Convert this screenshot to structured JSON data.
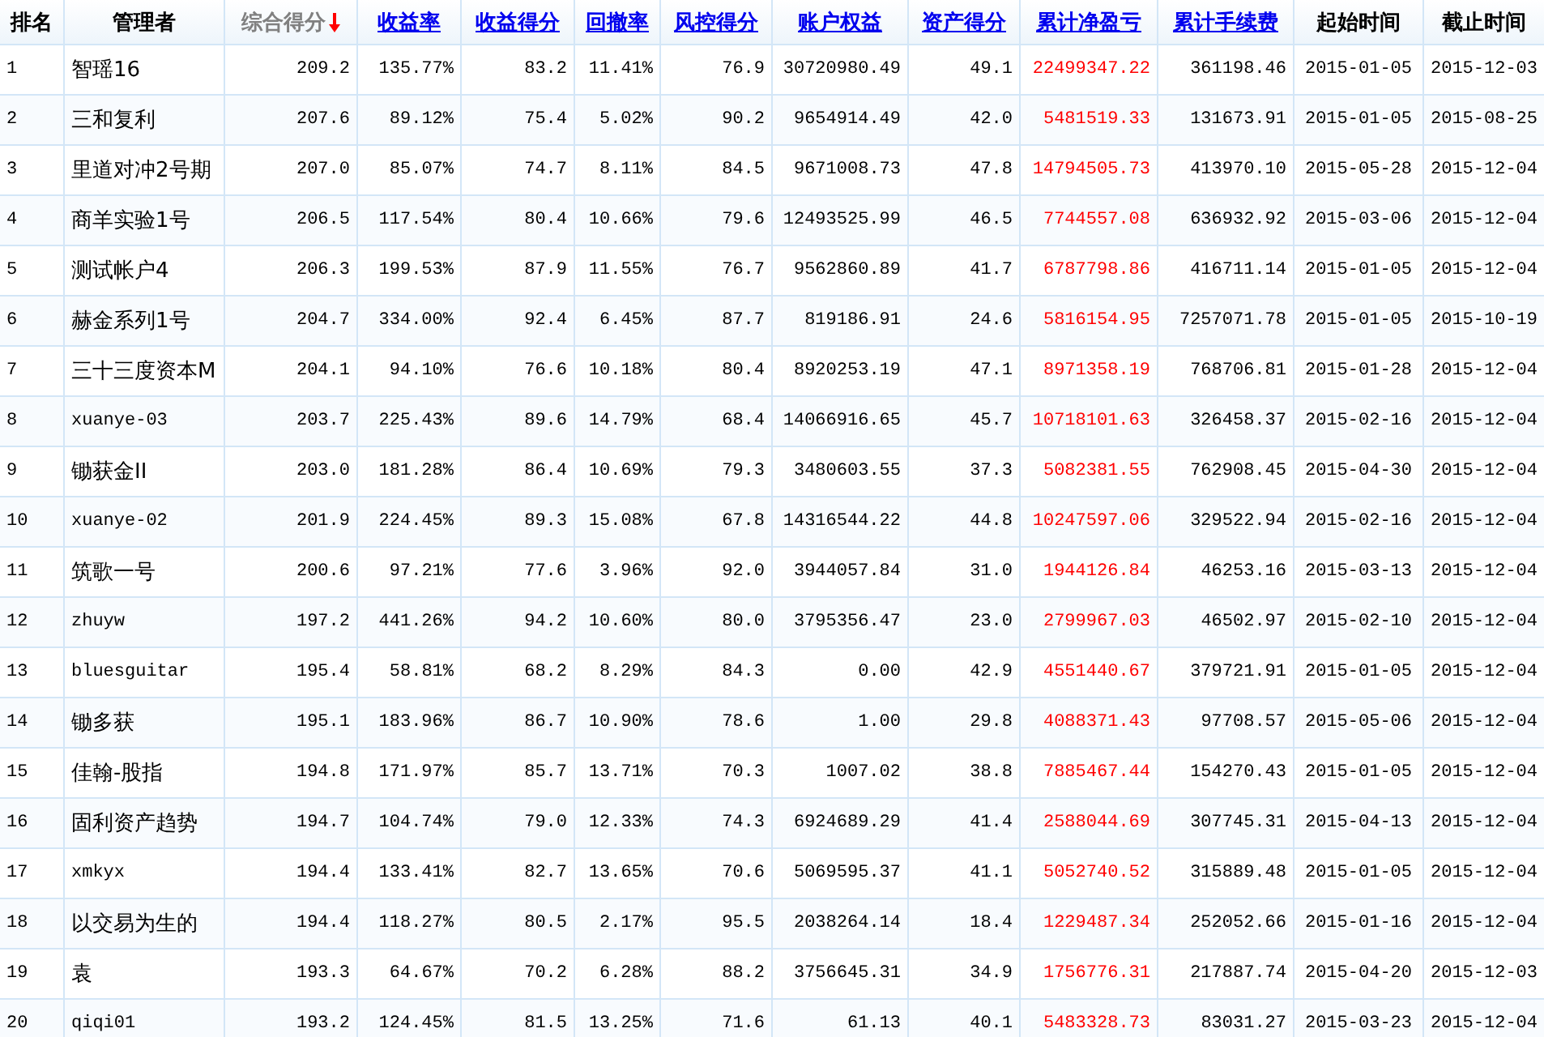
{
  "table": {
    "columns": [
      {
        "label": "排名",
        "kind": "plain"
      },
      {
        "label": "管理者",
        "kind": "plain"
      },
      {
        "label": "综合得分",
        "kind": "sorted",
        "descending": true
      },
      {
        "label": "收益率",
        "kind": "link"
      },
      {
        "label": "收益得分",
        "kind": "link"
      },
      {
        "label": "回撤率",
        "kind": "link"
      },
      {
        "label": "风控得分",
        "kind": "link"
      },
      {
        "label": "账户权益",
        "kind": "link"
      },
      {
        "label": "资产得分",
        "kind": "link"
      },
      {
        "label": "累计净盈亏",
        "kind": "link",
        "color": "#ff0000"
      },
      {
        "label": "累计手续费",
        "kind": "link"
      },
      {
        "label": "起始时间",
        "kind": "plain"
      },
      {
        "label": "截止时间",
        "kind": "plain"
      }
    ],
    "rows": [
      [
        "1",
        "智瑶16",
        "209.2",
        "135.77%",
        "83.2",
        "11.41%",
        "76.9",
        "30720980.49",
        "49.1",
        "22499347.22",
        "361198.46",
        "2015-01-05",
        "2015-12-03"
      ],
      [
        "2",
        "三和复利",
        "207.6",
        "89.12%",
        "75.4",
        "5.02%",
        "90.2",
        "9654914.49",
        "42.0",
        "5481519.33",
        "131673.91",
        "2015-01-05",
        "2015-08-25"
      ],
      [
        "3",
        "里道对冲2号期",
        "207.0",
        "85.07%",
        "74.7",
        "8.11%",
        "84.5",
        "9671008.73",
        "47.8",
        "14794505.73",
        "413970.10",
        "2015-05-28",
        "2015-12-04"
      ],
      [
        "4",
        "商羊实验1号",
        "206.5",
        "117.54%",
        "80.4",
        "10.66%",
        "79.6",
        "12493525.99",
        "46.5",
        "7744557.08",
        "636932.92",
        "2015-03-06",
        "2015-12-04"
      ],
      [
        "5",
        "测试帐户4",
        "206.3",
        "199.53%",
        "87.9",
        "11.55%",
        "76.7",
        "9562860.89",
        "41.7",
        "6787798.86",
        "416711.14",
        "2015-01-05",
        "2015-12-04"
      ],
      [
        "6",
        "赫金系列1号",
        "204.7",
        "334.00%",
        "92.4",
        "6.45%",
        "87.7",
        "819186.91",
        "24.6",
        "5816154.95",
        "7257071.78",
        "2015-01-05",
        "2015-10-19"
      ],
      [
        "7",
        "三十三度资本M",
        "204.1",
        "94.10%",
        "76.6",
        "10.18%",
        "80.4",
        "8920253.19",
        "47.1",
        "8971358.19",
        "768706.81",
        "2015-01-28",
        "2015-12-04"
      ],
      [
        "8",
        "xuanye-03",
        "203.7",
        "225.43%",
        "89.6",
        "14.79%",
        "68.4",
        "14066916.65",
        "45.7",
        "10718101.63",
        "326458.37",
        "2015-02-16",
        "2015-12-04"
      ],
      [
        "9",
        "锄获金II",
        "203.0",
        "181.28%",
        "86.4",
        "10.69%",
        "79.3",
        "3480603.55",
        "37.3",
        "5082381.55",
        "762908.45",
        "2015-04-30",
        "2015-12-04"
      ],
      [
        "10",
        "xuanye-02",
        "201.9",
        "224.45%",
        "89.3",
        "15.08%",
        "67.8",
        "14316544.22",
        "44.8",
        "10247597.06",
        "329522.94",
        "2015-02-16",
        "2015-12-04"
      ],
      [
        "11",
        "筑歌一号",
        "200.6",
        "97.21%",
        "77.6",
        "3.96%",
        "92.0",
        "3944057.84",
        "31.0",
        "1944126.84",
        "46253.16",
        "2015-03-13",
        "2015-12-04"
      ],
      [
        "12",
        "zhuyw",
        "197.2",
        "441.26%",
        "94.2",
        "10.60%",
        "80.0",
        "3795356.47",
        "23.0",
        "2799967.03",
        "46502.97",
        "2015-02-10",
        "2015-12-04"
      ],
      [
        "13",
        "bluesguitar",
        "195.4",
        "58.81%",
        "68.2",
        "8.29%",
        "84.3",
        "0.00",
        "42.9",
        "4551440.67",
        "379721.91",
        "2015-01-05",
        "2015-12-04"
      ],
      [
        "14",
        "锄多获",
        "195.1",
        "183.96%",
        "86.7",
        "10.90%",
        "78.6",
        "1.00",
        "29.8",
        "4088371.43",
        "97708.57",
        "2015-05-06",
        "2015-12-04"
      ],
      [
        "15",
        "佳翰-股指",
        "194.8",
        "171.97%",
        "85.7",
        "13.71%",
        "70.3",
        "1007.02",
        "38.8",
        "7885467.44",
        "154270.43",
        "2015-01-05",
        "2015-12-04"
      ],
      [
        "16",
        "固利资产趋势",
        "194.7",
        "104.74%",
        "79.0",
        "12.33%",
        "74.3",
        "6924689.29",
        "41.4",
        "2588044.69",
        "307745.31",
        "2015-04-13",
        "2015-12-04"
      ],
      [
        "17",
        "xmkyx",
        "194.4",
        "133.41%",
        "82.7",
        "13.65%",
        "70.6",
        "5069595.37",
        "41.1",
        "5052740.52",
        "315889.48",
        "2015-01-05",
        "2015-12-04"
      ],
      [
        "18",
        "以交易为生的",
        "194.4",
        "118.27%",
        "80.5",
        "2.17%",
        "95.5",
        "2038264.14",
        "18.4",
        "1229487.34",
        "252052.66",
        "2015-01-16",
        "2015-12-04"
      ],
      [
        "19",
        "袁",
        "193.3",
        "64.67%",
        "70.2",
        "6.28%",
        "88.2",
        "3756645.31",
        "34.9",
        "1756776.31",
        "217887.74",
        "2015-04-20",
        "2015-12-03"
      ],
      [
        "20",
        "qiqi01",
        "193.2",
        "124.45%",
        "81.5",
        "13.25%",
        "71.6",
        "61.13",
        "40.1",
        "5483328.73",
        "83031.27",
        "2015-03-23",
        "2015-12-04"
      ]
    ]
  }
}
